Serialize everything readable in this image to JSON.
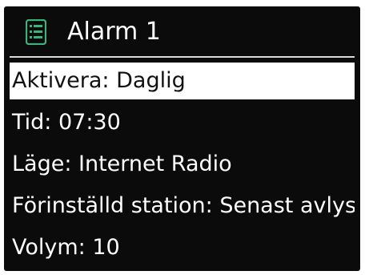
{
  "header": {
    "title": "Alarm 1",
    "icon": "list-icon",
    "icon_color": "#3bb37a"
  },
  "menu": {
    "items": [
      {
        "label": "Aktivera: Daglig",
        "selected": true
      },
      {
        "label": "Tid: 07:30",
        "selected": false
      },
      {
        "label": "Läge: Internet Radio",
        "selected": false
      },
      {
        "label": "Förinställd station: Senast avlyssnad",
        "selected": false
      },
      {
        "label": "Volym: 10",
        "selected": false
      }
    ]
  },
  "colors": {
    "background": "#0b0b0b",
    "text": "#ffffff",
    "highlight": "#ffffff",
    "highlight_text": "#111111"
  }
}
